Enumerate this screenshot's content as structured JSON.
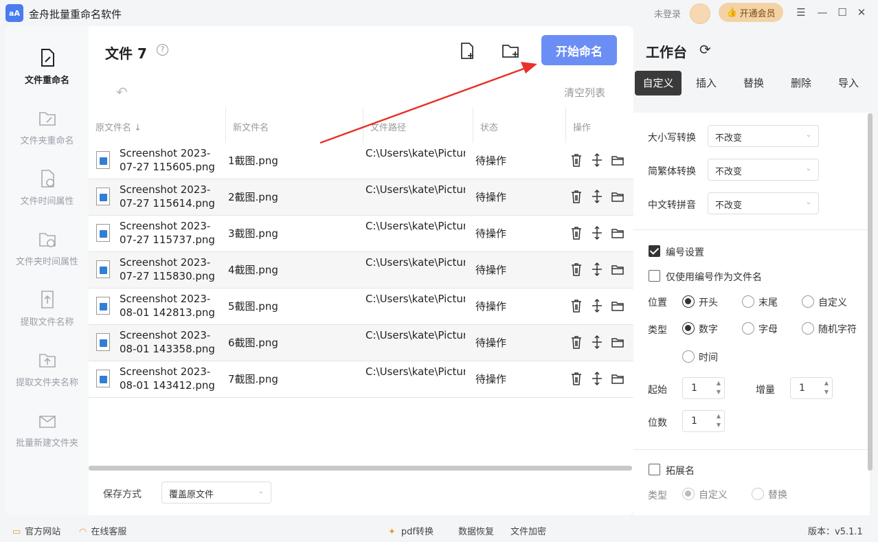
{
  "app": {
    "logo_text": "aA",
    "title": "金舟批量重命名软件",
    "login_text": "未登录",
    "vip_label": "开通会员"
  },
  "window_controls": [
    "☰",
    "—",
    "☐",
    "✕"
  ],
  "sidebar": {
    "items": [
      {
        "label": "文件重命名",
        "icon": "file-edit-icon",
        "active": true
      },
      {
        "label": "文件夹重命名",
        "icon": "folder-edit-icon"
      },
      {
        "label": "文件时间属性",
        "icon": "file-clock-icon"
      },
      {
        "label": "文件夹时间属性",
        "icon": "folder-clock-icon"
      },
      {
        "label": "提取文件名称",
        "icon": "file-upload-icon"
      },
      {
        "label": "提取文件夹名称",
        "icon": "folder-upload-icon"
      },
      {
        "label": "批量新建文件夹",
        "icon": "folder-envelope-icon"
      }
    ]
  },
  "main": {
    "title": "文件 7",
    "help_icon": "?",
    "start_button": "开始命名",
    "undo_icon": "↶",
    "clear_list": "清空列表",
    "columns": [
      "原文件名 ↓",
      "新文件名",
      "文件路径",
      "状态",
      "操作"
    ],
    "rows": [
      {
        "orig": "Screenshot 2023-07-27 115605.png",
        "new": "1截图.png",
        "path": "C:\\Users\\kate\\Pictures\\Screenshots...",
        "status": "待操作"
      },
      {
        "orig": "Screenshot 2023-07-27 115614.png",
        "new": "2截图.png",
        "path": "C:\\Users\\kate\\Pictures\\Screenshots...",
        "status": "待操作"
      },
      {
        "orig": "Screenshot 2023-07-27 115737.png",
        "new": "3截图.png",
        "path": "C:\\Users\\kate\\Pictures\\Screenshots...",
        "status": "待操作"
      },
      {
        "orig": "Screenshot 2023-07-27 115830.png",
        "new": "4截图.png",
        "path": "C:\\Users\\kate\\Pictures\\Screenshots...",
        "status": "待操作"
      },
      {
        "orig": "Screenshot 2023-08-01 142813.png",
        "new": "5截图.png",
        "path": "C:\\Users\\kate\\Pictures\\Screenshots...",
        "status": "待操作"
      },
      {
        "orig": "Screenshot 2023-08-01 143358.png",
        "new": "6截图.png",
        "path": "C:\\Users\\kate\\Pictures\\Screenshots...",
        "status": "待操作"
      },
      {
        "orig": "Screenshot 2023-08-01 143412.png",
        "new": "7截图.png",
        "path": "C:\\Users\\kate\\Pictures\\Screenshots...",
        "status": "待操作"
      }
    ],
    "save_label": "保存方式",
    "save_value": "覆盖原文件"
  },
  "workbench": {
    "title": "工作台",
    "refresh_icon": "⟳",
    "tabs": [
      "自定义",
      "插入",
      "替换",
      "删除",
      "导入"
    ],
    "case_label": "大小写转换",
    "case_value": "不改变",
    "simp_label": "简繁体转换",
    "simp_value": "不改变",
    "pinyin_label": "中文转拼音",
    "pinyin_value": "不改变",
    "numbering_label": "编号设置",
    "numbering_checked": true,
    "only_number_label": "仅使用编号作为文件名",
    "only_number_checked": false,
    "position_label": "位置",
    "position_options": [
      "开头",
      "末尾",
      "自定义"
    ],
    "position_selected": "开头",
    "type_label": "类型",
    "type_options": [
      "数字",
      "字母",
      "随机字符",
      "时间"
    ],
    "type_selected": "数字",
    "start_label": "起始",
    "start_value": "1",
    "increment_label": "增量",
    "increment_value": "1",
    "digits_label": "位数",
    "digits_value": "1",
    "extension_label": "拓展名",
    "extension_checked": false,
    "ext_type_label": "类型",
    "ext_type_options": [
      "自定义",
      "替换"
    ],
    "ext_type_selected": "自定义"
  },
  "footer": {
    "website": "官方网站",
    "service": "在线客服",
    "pdf": "pdf转换",
    "recovery": "数据恢复",
    "encrypt": "文件加密",
    "version": "版本：v5.1.1"
  },
  "colors": {
    "accent": "#6b8ef5",
    "annotation_arrow": "#e8322a",
    "vip": "#f3d3a6"
  }
}
